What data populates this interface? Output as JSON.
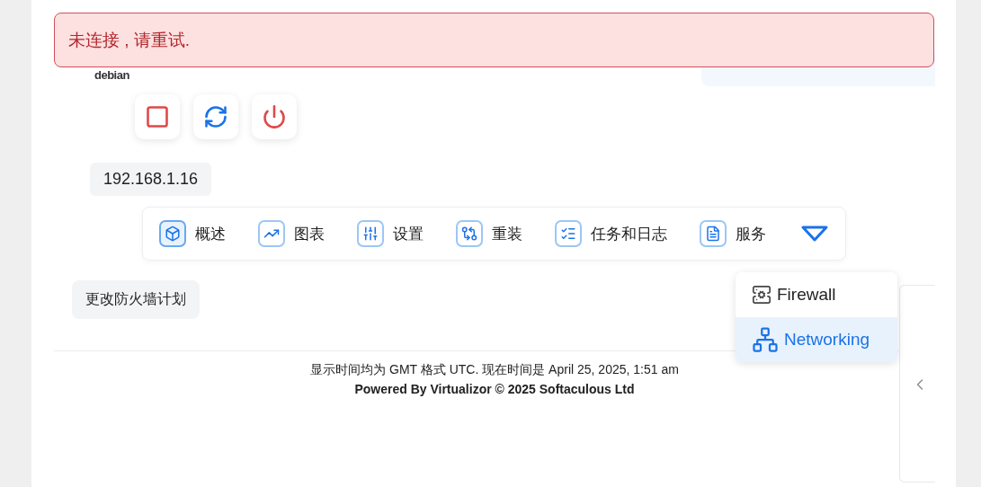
{
  "alert": {
    "message": "未连接 , 请重试."
  },
  "header": {
    "logo_text": "debian"
  },
  "power_buttons": [
    {
      "kind": "stop"
    },
    {
      "kind": "restart"
    },
    {
      "kind": "power"
    }
  ],
  "ip_address": "192.168.1.16",
  "tabs": [
    {
      "label": "概述",
      "kind": "cube",
      "selected": true
    },
    {
      "label": "图表",
      "kind": "chart",
      "selected": false
    },
    {
      "label": "设置",
      "kind": "sliders",
      "selected": false
    },
    {
      "label": "重装",
      "kind": "branch",
      "selected": false
    },
    {
      "label": "任务和日志",
      "kind": "checklist",
      "selected": false
    },
    {
      "label": "服务",
      "kind": "document",
      "selected": false
    }
  ],
  "more_menu": {
    "expanded": true,
    "items": [
      {
        "label": "Firewall",
        "kind": "firewall",
        "selected": false
      },
      {
        "label": "Networking",
        "kind": "network",
        "selected": true
      }
    ]
  },
  "action_button": "更改防火墙计划",
  "footer": {
    "timezone_note": "显示时间均为 GMT 格式 UTC. 现在时间是 April 25, 2025, 1:51 am",
    "powered_by": "Powered By Virtualizor © 2025 Softaculous Ltd"
  }
}
